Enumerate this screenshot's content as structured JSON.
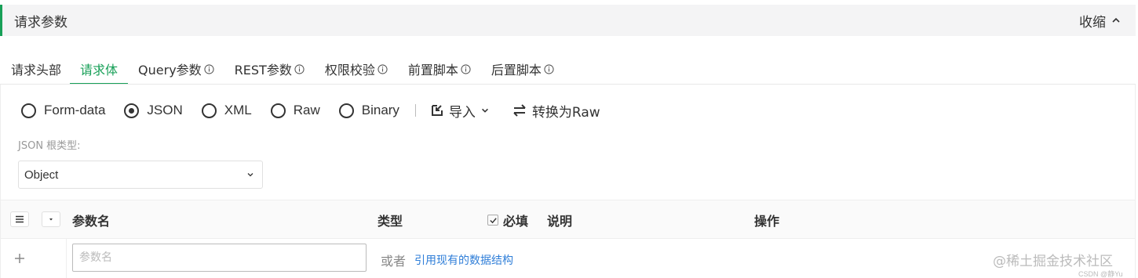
{
  "header": {
    "title": "请求参数",
    "collapse_label": "收缩"
  },
  "tabs": [
    {
      "label": "请求头部",
      "info": false,
      "active": false
    },
    {
      "label": "请求体",
      "info": false,
      "active": true
    },
    {
      "label": "Query参数",
      "info": true,
      "active": false
    },
    {
      "label": "REST参数",
      "info": true,
      "active": false
    },
    {
      "label": "权限校验",
      "info": true,
      "active": false
    },
    {
      "label": "前置脚本",
      "info": true,
      "active": false
    },
    {
      "label": "后置脚本",
      "info": true,
      "active": false
    }
  ],
  "body_types": [
    {
      "label": "Form-data",
      "selected": false
    },
    {
      "label": "JSON",
      "selected": true
    },
    {
      "label": "XML",
      "selected": false
    },
    {
      "label": "Raw",
      "selected": false
    },
    {
      "label": "Binary",
      "selected": false
    }
  ],
  "actions": {
    "import_label": "导入",
    "convert_label": "转换为Raw"
  },
  "root_type": {
    "label": "JSON 根类型:",
    "value": "Object"
  },
  "table": {
    "columns": {
      "name": "参数名",
      "type": "类型",
      "required": "必填",
      "desc": "说明",
      "ops": "操作"
    },
    "row": {
      "name_placeholder": "参数名",
      "or_text": "或者",
      "ref_link": "引用现有的数据结构"
    }
  },
  "watermark": {
    "main": "@稀土掘金技术社区",
    "sub": "CSDN @静Yu"
  },
  "colors": {
    "accent": "#18a058",
    "link": "#2f7ed8"
  }
}
